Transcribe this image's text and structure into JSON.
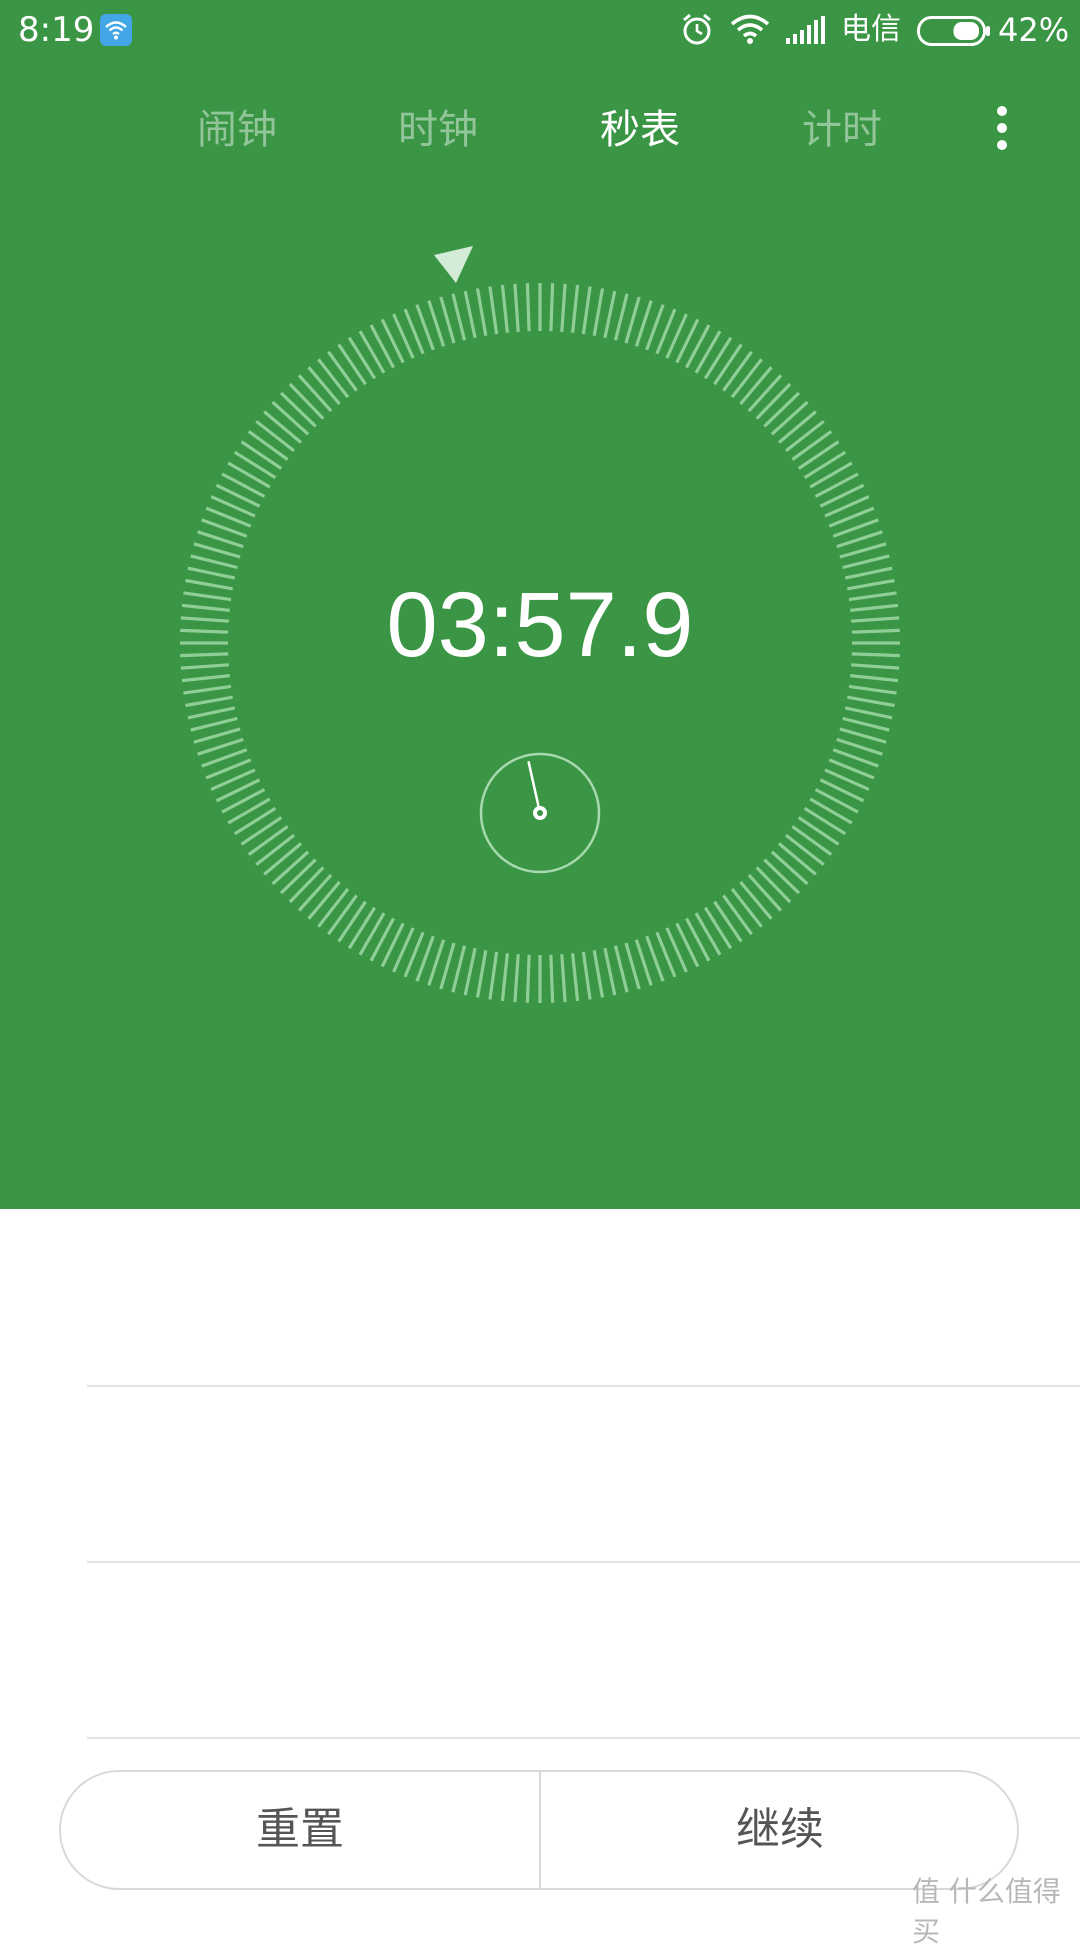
{
  "status_bar": {
    "time": "8:19",
    "carrier": "电信",
    "battery_percent": "42%",
    "battery_level": 0.42,
    "icons": [
      "wifi-notification-icon",
      "alarm-icon",
      "wifi-signal-icon",
      "cell-signal-icon",
      "battery-icon"
    ]
  },
  "tabs": [
    {
      "label": "闹钟",
      "active": false
    },
    {
      "label": "时钟",
      "active": false
    },
    {
      "label": "秒表",
      "active": true
    },
    {
      "label": "计时",
      "active": false
    }
  ],
  "stopwatch": {
    "elapsed": "03:57.9",
    "seconds_fraction": 0.965
  },
  "controls": {
    "reset_label": "重置",
    "resume_label": "继续"
  },
  "watermark": "值 什么值得买",
  "colors": {
    "accent": "#3a9645",
    "tick": "#8fcf97",
    "text_inactive": "rgba(255,255,255,0.45)"
  }
}
